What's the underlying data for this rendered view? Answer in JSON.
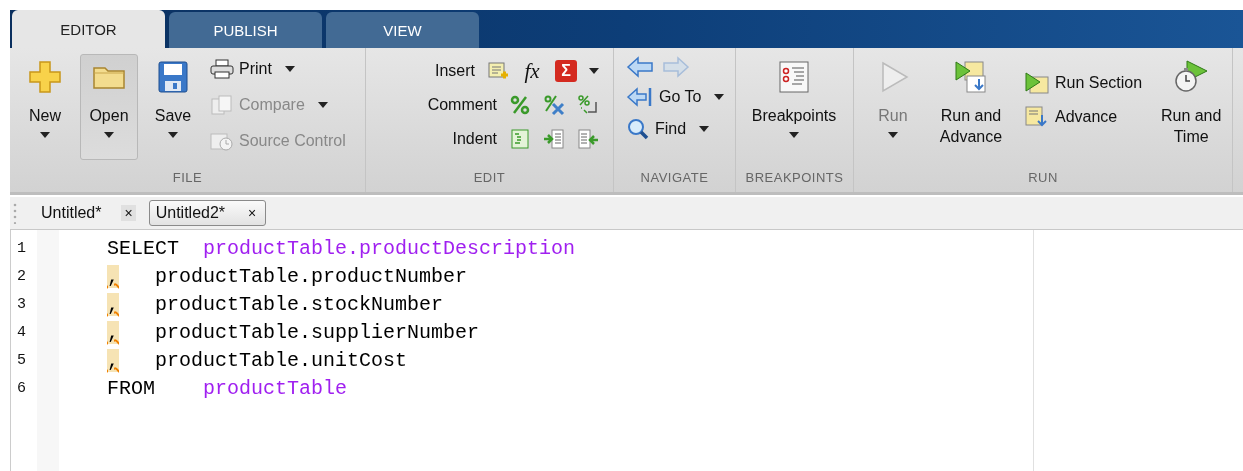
{
  "tabs": [
    {
      "label": "EDITOR",
      "selected": true
    },
    {
      "label": "PUBLISH",
      "selected": false
    },
    {
      "label": "VIEW",
      "selected": false
    }
  ],
  "ribbon": {
    "file": {
      "title": "FILE",
      "large_buttons": [
        {
          "label": "New",
          "dropdown": true,
          "pressed": false
        },
        {
          "label": "Open",
          "dropdown": true,
          "pressed": true
        },
        {
          "label": "Save",
          "dropdown": true,
          "pressed": false
        }
      ],
      "small_buttons": [
        {
          "label": "Print",
          "dropdown": true,
          "disabled": false
        },
        {
          "label": "Compare",
          "dropdown": true,
          "disabled": true
        },
        {
          "label": "Source Control",
          "dropdown": false,
          "disabled": true
        }
      ]
    },
    "edit": {
      "title": "EDIT",
      "rows": [
        {
          "label": "Insert",
          "dropdown": true,
          "symbols": [
            "fx",
            "Σ"
          ]
        },
        {
          "label": "Comment",
          "dropdown": false
        },
        {
          "label": "Indent",
          "dropdown": false
        }
      ]
    },
    "navigate": {
      "title": "NAVIGATE",
      "arrows": [
        {
          "disabled": false
        },
        {
          "disabled": true
        }
      ],
      "items": [
        {
          "label": "Go To",
          "dropdown": true
        },
        {
          "label": "Find",
          "dropdown": true
        }
      ]
    },
    "breakpoints": {
      "title": "BREAKPOINTS",
      "button": {
        "label": "Breakpoints",
        "dropdown": true
      }
    },
    "run": {
      "title": "RUN",
      "run": {
        "label": "Run",
        "dropdown": true,
        "disabled": true
      },
      "run_and_advance": {
        "label": "Run and Advance",
        "disabled": false
      },
      "small_buttons": [
        {
          "label": "Run Section"
        },
        {
          "label": "Advance"
        }
      ],
      "run_and_time": {
        "label": "Run and Time",
        "disabled": false
      }
    }
  },
  "documents": [
    {
      "label": "Untitled*",
      "close": "×",
      "selected": false
    },
    {
      "label": "Untitled2*",
      "close": "×",
      "selected": true
    }
  ],
  "editor": {
    "lines": [
      {
        "number": "1",
        "warning": false,
        "tokens": [
          {
            "text": "SELECT  ",
            "kind": "keyword"
          },
          {
            "text": "productTable.productDescription",
            "kind": "string"
          }
        ]
      },
      {
        "number": "2",
        "warning": true,
        "tokens": [
          {
            "text": ",",
            "kind": "plain"
          },
          {
            "text": "   productTable.productNumber",
            "kind": "plain"
          }
        ]
      },
      {
        "number": "3",
        "warning": true,
        "tokens": [
          {
            "text": ",",
            "kind": "plain"
          },
          {
            "text": "   productTable.stockNumber",
            "kind": "plain"
          }
        ]
      },
      {
        "number": "4",
        "warning": true,
        "tokens": [
          {
            "text": ",",
            "kind": "plain"
          },
          {
            "text": "   productTable.supplierNumber",
            "kind": "plain"
          }
        ]
      },
      {
        "number": "5",
        "warning": true,
        "tokens": [
          {
            "text": ",",
            "kind": "plain"
          },
          {
            "text": "   productTable.unitCost",
            "kind": "plain"
          }
        ]
      },
      {
        "number": "6",
        "warning": false,
        "tokens": [
          {
            "text": "FROM    ",
            "kind": "keyword"
          },
          {
            "text": "productTable",
            "kind": "string"
          }
        ]
      }
    ]
  }
}
